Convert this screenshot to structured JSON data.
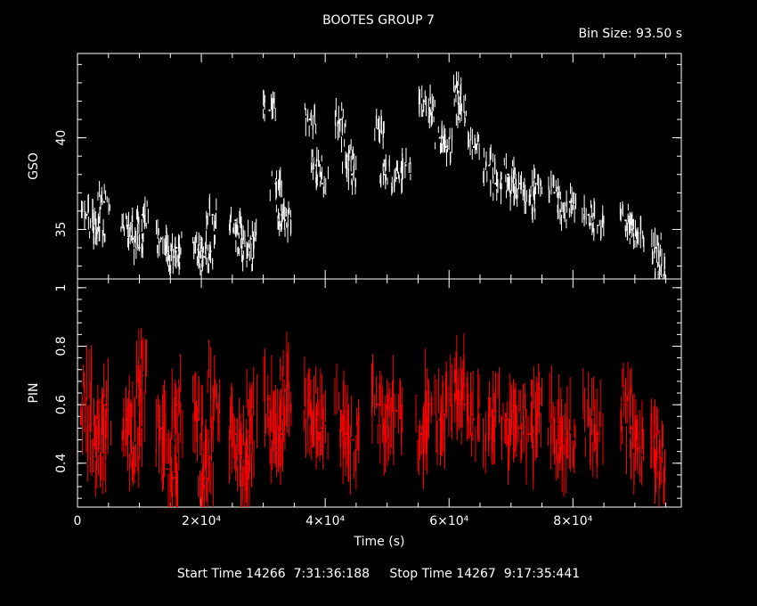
{
  "title": "BOOTES GROUP 7",
  "bin_size": "Bin Size: 93.50 s",
  "footer": {
    "start_label": "Start Time 14266",
    "start_value": "7:31:36:188",
    "stop_label": "Stop Time 14267",
    "stop_value": "9:17:35:441"
  },
  "colors": {
    "background": "#000000",
    "axes": "#ffffff",
    "gso": "#ffffff",
    "pin": "#ff0000"
  },
  "chart_data": [
    {
      "type": "scatter",
      "panel": "top",
      "ylabel": "GSO",
      "xlim": [
        0,
        97500
      ],
      "ylim": [
        32.3,
        44.6
      ],
      "yticks": [
        35,
        40
      ],
      "ytick_labels": [
        "35",
        "40"
      ],
      "grid": false,
      "series": [
        {
          "color": "#ffffff",
          "x": [
            1500,
            2500,
            3500,
            4300,
            8000,
            9000,
            10000,
            10500,
            13500,
            14500,
            15500,
            16000,
            19500,
            20500,
            21500,
            21800,
            25500,
            26500,
            27500,
            28000,
            31000,
            32000,
            33000,
            33500,
            37500,
            38500,
            39500,
            42500,
            43500,
            44300,
            48500,
            49500,
            51500,
            53000,
            56000,
            56800,
            58500,
            59500,
            61500,
            62000,
            64000,
            66500,
            67500,
            69500,
            70000,
            71500,
            73000,
            74000,
            77000,
            78000,
            79500,
            82500,
            84000,
            88500,
            89500,
            90500,
            93500,
            94000
          ],
          "y": [
            35.8,
            35.0,
            34.9,
            36.5,
            35.2,
            34.5,
            34.0,
            35.8,
            34.5,
            33.8,
            33.5,
            34.0,
            33.9,
            33.5,
            33.8,
            35.8,
            35.5,
            34.5,
            33.6,
            34.5,
            41.5,
            37.5,
            35.8,
            35.5,
            41.0,
            38.5,
            37.5,
            41.0,
            39.0,
            38.0,
            40.5,
            38.0,
            37.8,
            38.5,
            42.0,
            41.5,
            40.0,
            39.5,
            42.5,
            41.5,
            39.5,
            38.5,
            37.5,
            38.0,
            37.0,
            37.5,
            36.5,
            37.5,
            37.0,
            36.0,
            36.5,
            35.8,
            35.2,
            35.5,
            35.0,
            34.8,
            34.0,
            32.8
          ]
        }
      ]
    },
    {
      "type": "scatter",
      "panel": "bottom",
      "xlabel": "Time (s)",
      "ylabel": "PIN",
      "xlim": [
        0,
        97500
      ],
      "ylim": [
        0.25,
        1.03
      ],
      "yticks": [
        0.4,
        0.6,
        0.8,
        1
      ],
      "ytick_labels": [
        "0.4",
        "0.6",
        "0.8",
        "1"
      ],
      "xticks": [
        0,
        20000,
        40000,
        60000,
        80000
      ],
      "xtick_labels": [
        "0",
        "2×10⁴",
        "4×10⁴",
        "6×10⁴",
        "8×10⁴"
      ],
      "grid": false,
      "series": [
        {
          "color": "#ff0000",
          "x": [
            1500,
            2500,
            3500,
            4500,
            8000,
            9000,
            10000,
            10500,
            13500,
            14500,
            15500,
            16000,
            19500,
            20500,
            21500,
            22000,
            25500,
            26500,
            27500,
            28000,
            31000,
            32000,
            33000,
            33500,
            37500,
            38500,
            39500,
            42500,
            43500,
            44500,
            48500,
            49500,
            51500,
            55500,
            56800,
            58500,
            59500,
            61500,
            62500,
            64000,
            66500,
            67500,
            69500,
            70000,
            71500,
            73000,
            74000,
            77000,
            78000,
            79500,
            82500,
            84000,
            88500,
            89500,
            90500,
            93500,
            94000
          ],
          "y": [
            0.62,
            0.48,
            0.45,
            0.6,
            0.55,
            0.45,
            0.5,
            0.7,
            0.52,
            0.38,
            0.35,
            0.6,
            0.55,
            0.35,
            0.42,
            0.65,
            0.5,
            0.42,
            0.4,
            0.55,
            0.62,
            0.48,
            0.5,
            0.65,
            0.58,
            0.55,
            0.52,
            0.55,
            0.5,
            0.48,
            0.6,
            0.55,
            0.58,
            0.5,
            0.6,
            0.55,
            0.58,
            0.65,
            0.6,
            0.55,
            0.52,
            0.58,
            0.55,
            0.5,
            0.52,
            0.5,
            0.55,
            0.55,
            0.48,
            0.5,
            0.55,
            0.5,
            0.6,
            0.52,
            0.45,
            0.5,
            0.42
          ]
        }
      ]
    }
  ]
}
